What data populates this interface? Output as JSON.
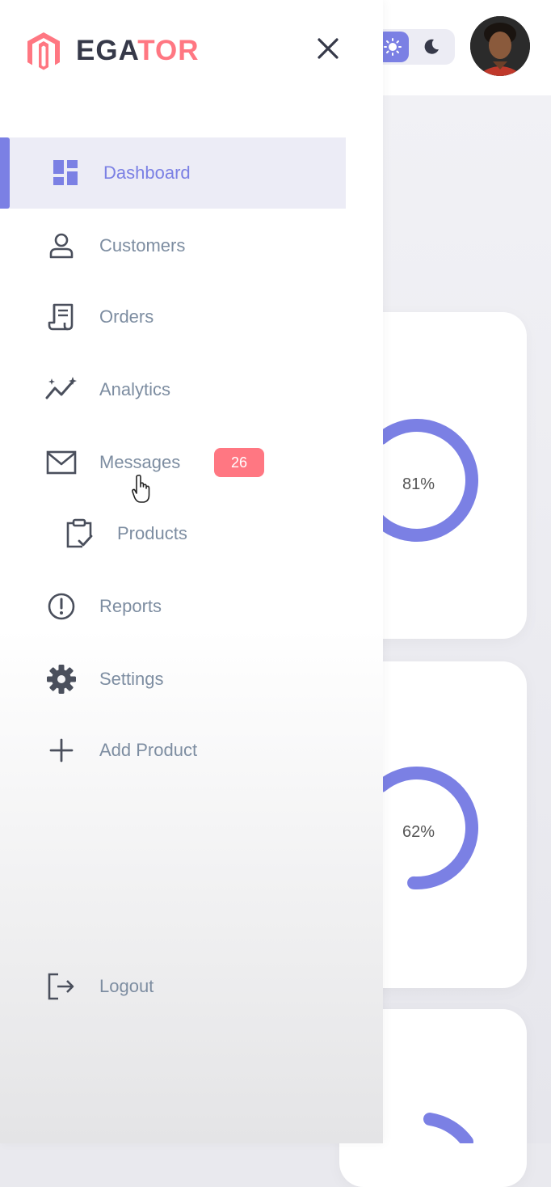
{
  "brand": {
    "logo_dark": "EGA",
    "logo_accent": "TOR",
    "colors": {
      "accent": "#7b80e4",
      "danger": "#ff7782",
      "text_muted": "#7d8da1",
      "logo_dark": "#363949"
    }
  },
  "sidebar": {
    "close_icon": "close-icon",
    "items": [
      {
        "label": "Dashboard",
        "icon": "dashboard-icon",
        "active": true
      },
      {
        "label": "Customers",
        "icon": "person-icon"
      },
      {
        "label": "Orders",
        "icon": "receipt-icon"
      },
      {
        "label": "Analytics",
        "icon": "analytics-icon"
      },
      {
        "label": "Messages",
        "icon": "mail-icon",
        "badge": "26"
      },
      {
        "label": "Products",
        "icon": "clipboard-check-icon"
      },
      {
        "label": "Reports",
        "icon": "alert-circle-icon"
      },
      {
        "label": "Settings",
        "icon": "gear-icon"
      },
      {
        "label": "Add Product",
        "icon": "plus-icon"
      }
    ],
    "logout": {
      "label": "Logout",
      "icon": "logout-icon"
    }
  },
  "header": {
    "theme_toggle": {
      "light_icon": "sun-icon",
      "dark_icon": "moon-icon",
      "active": "light"
    },
    "avatar": "avatar"
  },
  "cards": [
    {
      "percent_label": "81%",
      "percent": 81
    },
    {
      "percent_label": "62%",
      "percent": 62
    }
  ]
}
